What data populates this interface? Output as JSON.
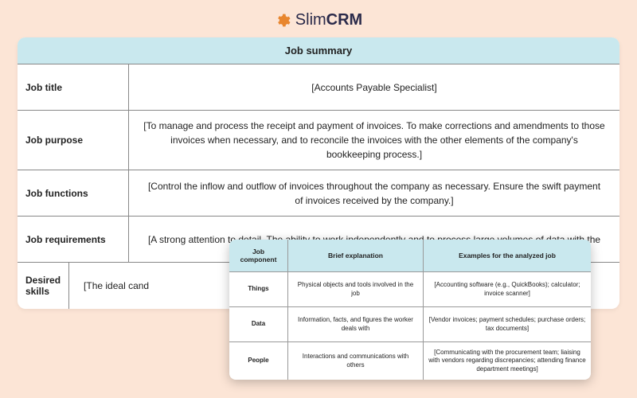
{
  "brand": {
    "name": "SlimCRM"
  },
  "main": {
    "title": "Job summary",
    "rows": [
      {
        "label": "Job title",
        "value": "[Accounts Payable Specialist]"
      },
      {
        "label": "Job purpose",
        "value": "[To manage and process the receipt and payment of invoices. To make corrections and amendments to those invoices when necessary, and to reconcile the invoices with the other elements of the company's bookkeeping process.]"
      },
      {
        "label": "Job functions",
        "value": "[Control the inflow and outflow of invoices throughout the company as necessary. Ensure the swift payment of invoices received by the company.]"
      },
      {
        "label": "Job requirements",
        "value": "[A strong attention to detail. The ability to work independently and to process large volumes of data with the"
      },
      {
        "label": "Desired skills",
        "value": "[The ideal cand                                                                                                                                                                                         for long perio"
      }
    ]
  },
  "overlay": {
    "headers": {
      "c1": "Job component",
      "c2": "Brief explanation",
      "c3": "Examples for the analyzed job"
    },
    "rows": [
      {
        "c1": "Things",
        "c2": "Physical objects and tools involved in the job",
        "c3": "[Accounting software (e.g., QuickBooks); calculator; invoice scanner]"
      },
      {
        "c1": "Data",
        "c2": "Information, facts, and figures the worker deals with",
        "c3": "[Vendor invoices; payment schedules; purchase orders; tax documents]"
      },
      {
        "c1": "People",
        "c2": "Interactions and communications with others",
        "c3": "[Communicating with the procurement team; liaising with vendors regarding discrepancies; attending finance department meetings]"
      }
    ]
  }
}
